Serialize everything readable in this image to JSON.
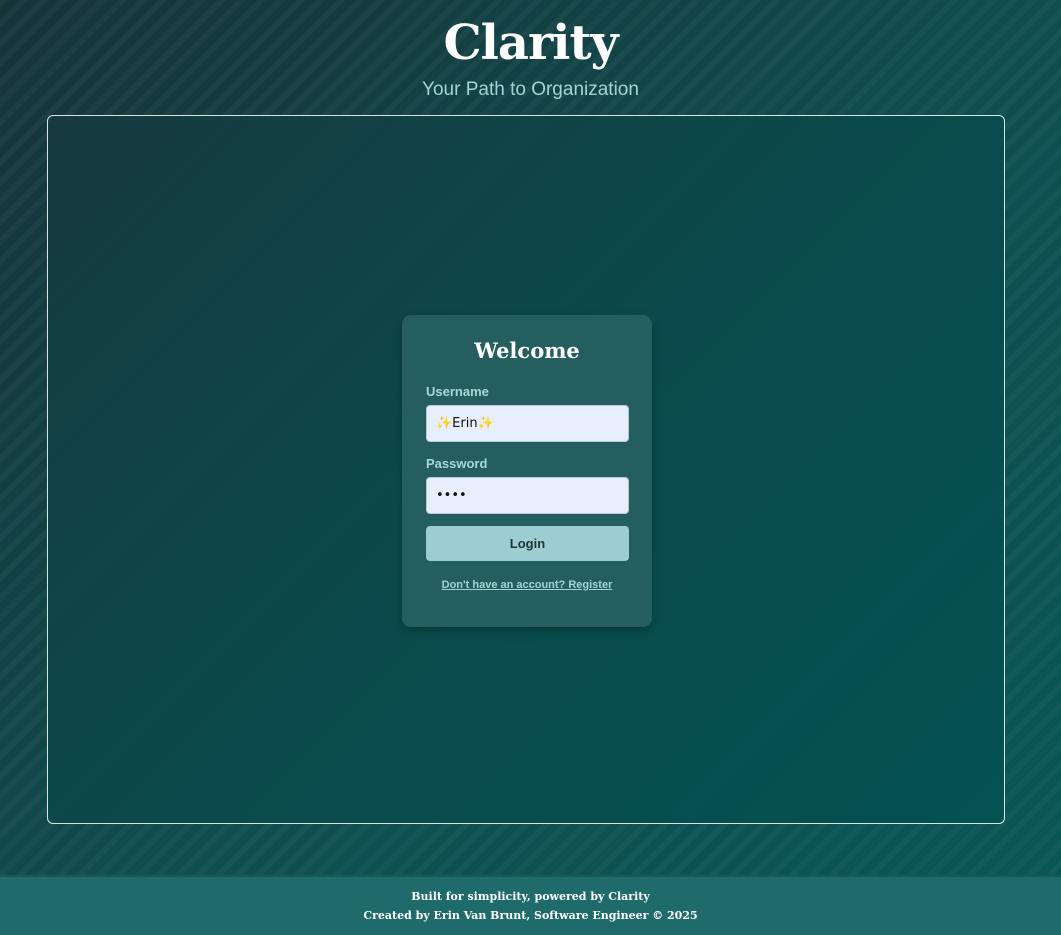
{
  "header": {
    "title": "Clarity",
    "subtitle": "Your Path to Organization"
  },
  "login": {
    "heading": "Welcome",
    "username_label": "Username",
    "username_value": "✨Erin✨",
    "password_label": "Password",
    "password_value": "••••",
    "login_button_label": "Login",
    "register_link_label": "Don't have an account? Register"
  },
  "footer": {
    "line1": "Built for simplicity, powered by Clarity",
    "line2": "Created by Erin Van Brunt, Software Engineer © 2025"
  },
  "colors": {
    "background": "#173f42",
    "card": "#245e5f",
    "button": "#9ccdd1",
    "input": "#e7eefc",
    "accent_text": "#a3d4d4",
    "footer": "#1f6a6a"
  }
}
